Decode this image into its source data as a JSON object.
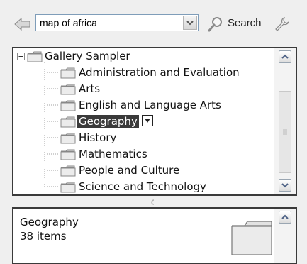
{
  "toolbar": {
    "search_value": "map of africa",
    "search_label": "Search",
    "icons": {
      "back": "back-arrow-icon",
      "dropdown": "chevron-down-icon",
      "search": "magnifier-icon",
      "tools": "wrench-icon"
    }
  },
  "tree": {
    "root": {
      "label": "Gallery Sampler",
      "expanded": true
    },
    "items": [
      {
        "label": "Administration and Evaluation",
        "selected": false
      },
      {
        "label": "Arts",
        "selected": false
      },
      {
        "label": "English and Language Arts",
        "selected": false
      },
      {
        "label": "Geography",
        "selected": true
      },
      {
        "label": "History",
        "selected": false
      },
      {
        "label": "Mathematics",
        "selected": false
      },
      {
        "label": "People and Culture",
        "selected": false
      },
      {
        "label": "Science and Technology",
        "selected": false
      }
    ]
  },
  "details": {
    "name": "Geography",
    "count": "38 items"
  },
  "colors": {
    "selection": "#3a3a3a",
    "panel_border": "#3a3a3a",
    "background": "#efefef"
  }
}
